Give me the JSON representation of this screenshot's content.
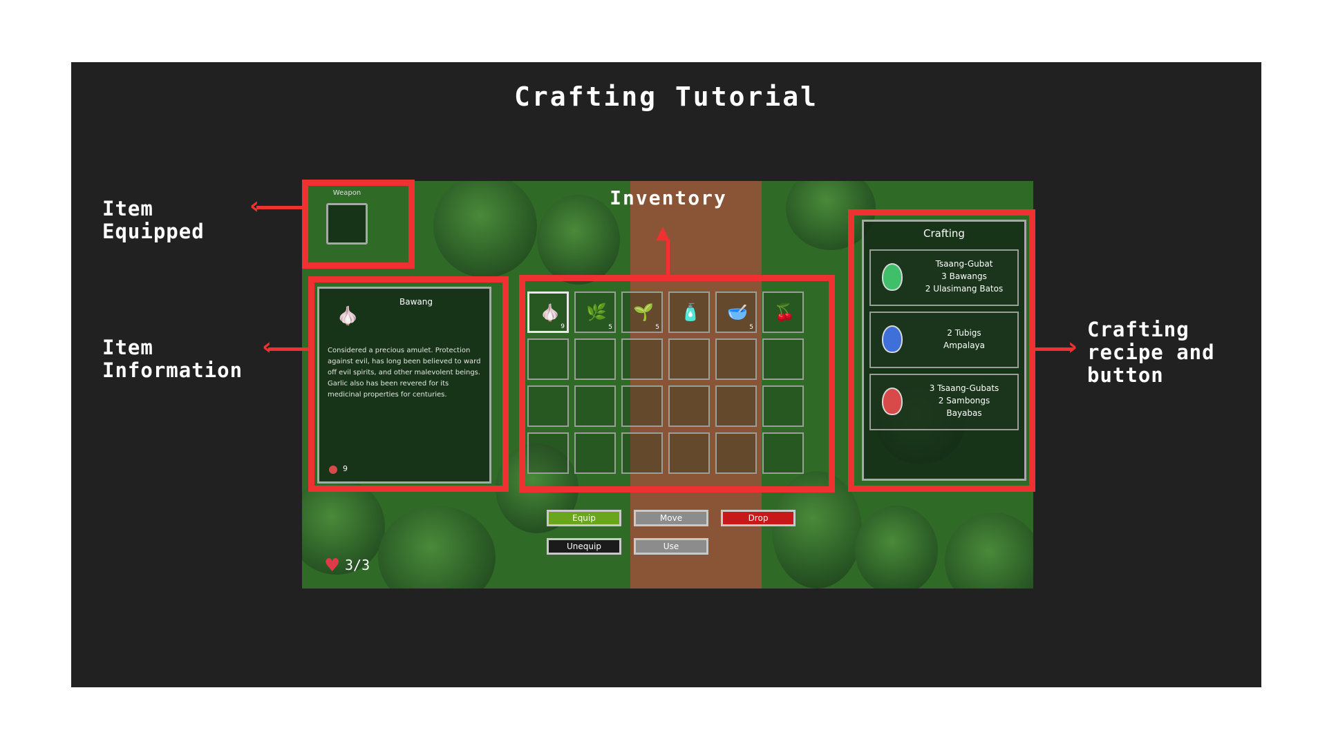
{
  "tutorial": {
    "title": "Crafting Tutorial",
    "callouts": {
      "item_equipped": [
        "Item",
        "Equipped"
      ],
      "item_information": [
        "Item",
        "Information"
      ],
      "crafting": [
        "Crafting",
        "recipe and",
        "button"
      ]
    }
  },
  "game": {
    "weapon_label": "Weapon",
    "inventory_title": "Inventory",
    "item_info": {
      "name": "Bawang",
      "description": "Considered a precious amulet. Protection against evil, has long been believed to ward off evil spirits, and other malevolent beings. Garlic also has been revered for its medicinal properties for centuries.",
      "value": "9"
    },
    "inventory": {
      "slots": [
        {
          "icon": "garlic-icon",
          "glyph": "🧄",
          "count": "9",
          "selected": true
        },
        {
          "icon": "herb-icon",
          "glyph": "🌿",
          "count": "5"
        },
        {
          "icon": "vine-icon",
          "glyph": "🌱",
          "count": "5"
        },
        {
          "icon": "bottle-icon",
          "glyph": "🧴",
          "count": ""
        },
        {
          "icon": "bowl-icon",
          "glyph": "🥣",
          "count": "5"
        },
        {
          "icon": "berry-branch-icon",
          "glyph": "🍒",
          "count": ""
        }
      ]
    },
    "crafting": {
      "title": "Crafting",
      "recipes": [
        {
          "icon": "green-potion-icon",
          "color": "#3fbf6a",
          "lines": [
            "Tsaang-Gubat",
            "3 Bawangs",
            "2 Ulasimang Batos"
          ]
        },
        {
          "icon": "blue-potion-icon",
          "color": "#3f6fd8",
          "lines": [
            "2 Tubigs",
            "Ampalaya"
          ]
        },
        {
          "icon": "red-potion-icon",
          "color": "#d84a4a",
          "lines": [
            "3 Tsaang-Gubats",
            "2 Sambongs",
            "Bayabas"
          ]
        }
      ]
    },
    "buttons": {
      "equip": "Equip",
      "move": "Move",
      "drop": "Drop",
      "unequip": "Unequip",
      "use": "Use"
    },
    "health": "3/3",
    "colors": {
      "equip": "#6aa51e",
      "move": "#8c8c8c",
      "drop": "#c81818",
      "unequip": "#1b1b1b",
      "use": "#8c8c8c",
      "highlight": "#f03131"
    }
  }
}
